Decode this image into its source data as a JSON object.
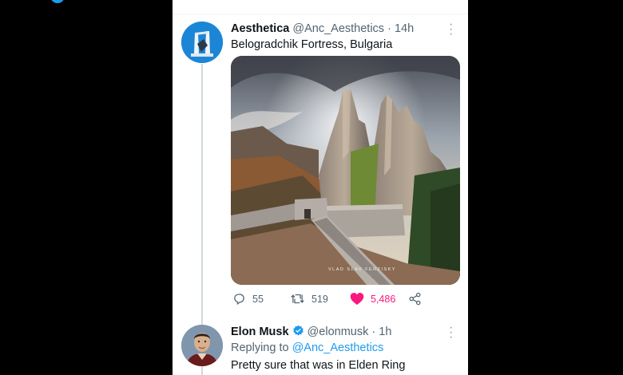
{
  "tweet": {
    "author_name": "Aesthetica",
    "author_handle": "@Anc_Aesthetics",
    "time": "14h",
    "text": "Belogradchik Fortress, Bulgaria",
    "image_watermark": "VLAD SLAV FERZISKY",
    "replies": "55",
    "retweets": "519",
    "likes": "5,486",
    "like_color": "#f91880"
  },
  "reply": {
    "author_name": "Elon Musk",
    "author_handle": "@elonmusk",
    "time": "1h",
    "replying_label": "Replying to",
    "replying_to": "@Anc_Aesthetics",
    "text": "Pretty sure that was in Elden Ring"
  },
  "colors": {
    "accent": "#1d9bf0",
    "muted": "#536471",
    "text": "#0f1419"
  }
}
